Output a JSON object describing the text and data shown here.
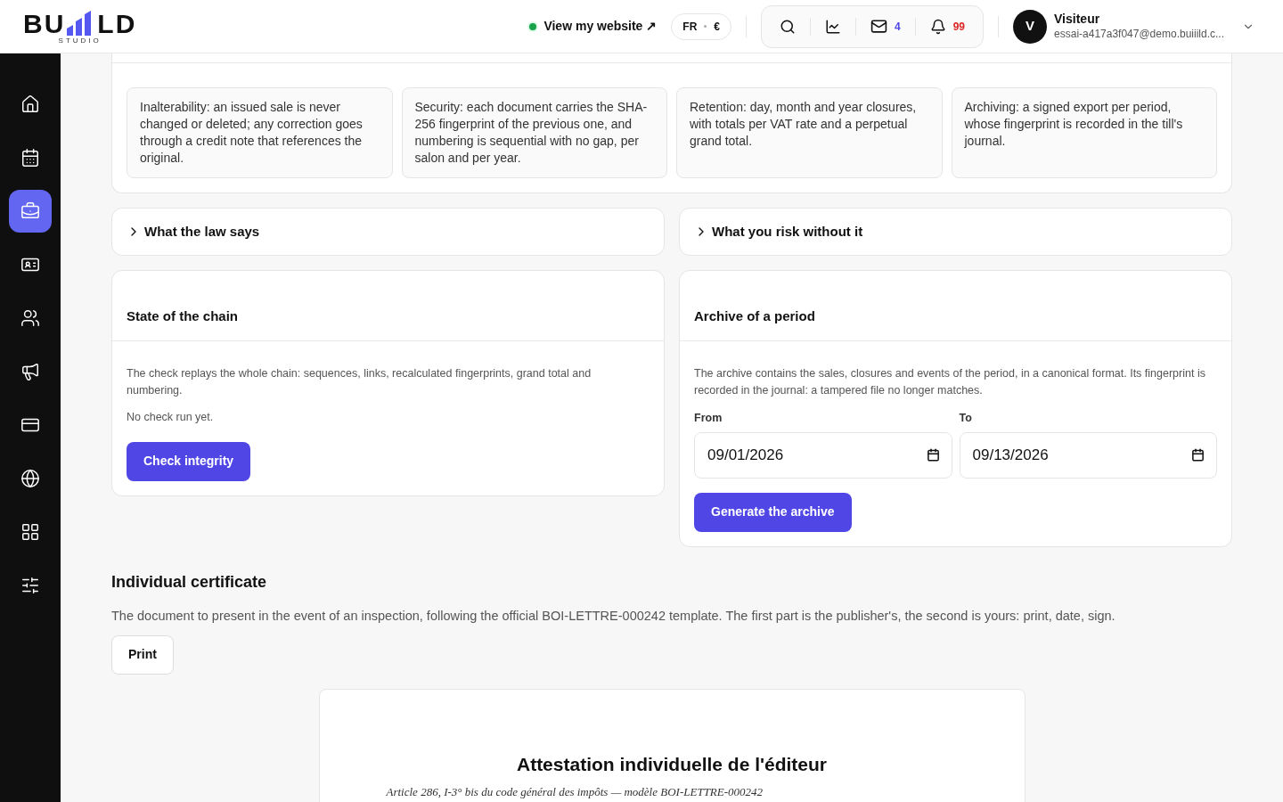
{
  "logo": {
    "word_start": "BU",
    "word_end": "LD",
    "tagline": "STUDIO"
  },
  "header": {
    "website_link": "View my website ↗",
    "locale": "FR",
    "currency": "€",
    "messages_count": "4",
    "notifications_count": "99",
    "user": {
      "initial": "V",
      "name": "Visiteur",
      "email": "essai-a417a3f047@demo.buiiild.c..."
    }
  },
  "sidebar": {
    "items": [
      {
        "kind": "home",
        "selected": false
      },
      {
        "kind": "calendar",
        "selected": false
      },
      {
        "kind": "register",
        "selected": true
      },
      {
        "kind": "contact-card",
        "selected": false
      },
      {
        "kind": "people",
        "selected": false
      },
      {
        "kind": "megaphone",
        "selected": false
      },
      {
        "kind": "card",
        "selected": false
      },
      {
        "kind": "globe",
        "selected": false
      },
      {
        "kind": "apps",
        "selected": false
      },
      {
        "kind": "sliders",
        "selected": false
      }
    ]
  },
  "principles": [
    "Inalterability: an issued sale is never changed or deleted; any correction goes through a credit note that references the original.",
    "Security: each document carries the SHA-256 fingerprint of the previous one, and numbering is sequential with no gap, per salon and per year.",
    "Retention: day, month and year closures, with totals per VAT rate and a perpetual grand total.",
    "Archiving: a signed export per period, whose fingerprint is recorded in the till's journal."
  ],
  "accordions": [
    {
      "title": "What the law says",
      "expanded": false
    },
    {
      "title": "What you risk without it",
      "expanded": false
    }
  ],
  "chain": {
    "title": "State of the chain",
    "description": "The check replays the whole chain: sequences, links, recalculated fingerprints, grand total and numbering.",
    "status": "No check run yet.",
    "button": "Check integrity"
  },
  "archive": {
    "title": "Archive of a period",
    "description": "The archive contains the sales, closures and events of the period, in a canonical format. Its fingerprint is recorded in the journal: a tampered file no longer matches.",
    "from_label": "From",
    "from_value": "09/01/2026",
    "to_label": "To",
    "to_value": "09/13/2026",
    "button": "Generate the archive"
  },
  "certificate": {
    "title": "Individual certificate",
    "description": "The document to present in the event of an inspection, following the official BOI-LETTRE-000242 template. The first part is the publisher's, the second is yours: print, date, sign.",
    "button": "Print",
    "document_title": "Attestation individuelle de l'éditeur",
    "document_subtitle": "Article 286, I-3° bis du code général des impôts — modèle BOI-LETTRE-000242"
  }
}
